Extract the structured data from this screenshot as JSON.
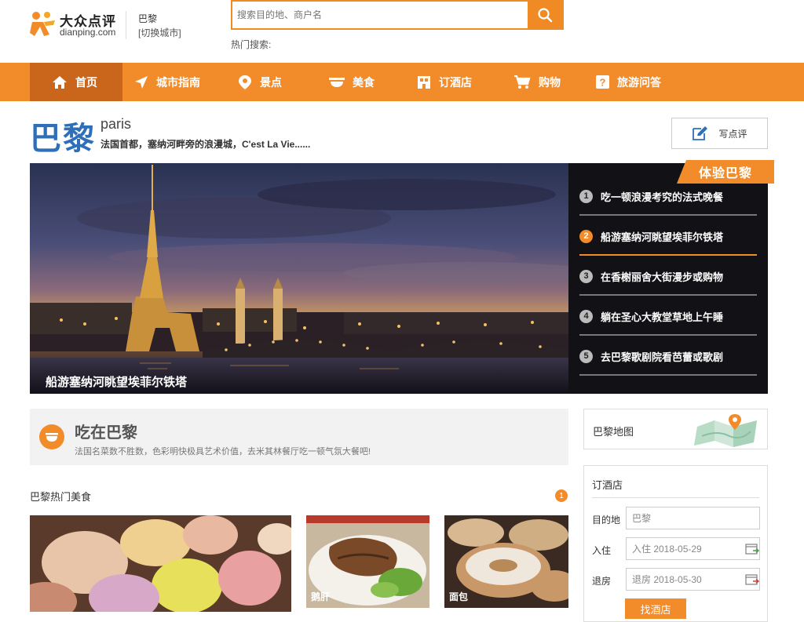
{
  "header": {
    "logo_cn": "大众点评",
    "logo_en": "dianping.com",
    "city": "巴黎",
    "city_switch": "[切换城市]",
    "search_placeholder": "搜索目的地、商户名",
    "hot_label": "热门搜索:"
  },
  "nav": [
    {
      "label": "首页",
      "icon": "home-icon",
      "active": true
    },
    {
      "label": "城市指南",
      "icon": "navigation-arrow-icon"
    },
    {
      "label": "景点",
      "icon": "location-pin-icon"
    },
    {
      "label": "美食",
      "icon": "food-bowl-icon"
    },
    {
      "label": "订酒店",
      "icon": "hotel-icon"
    },
    {
      "label": "购物",
      "icon": "shopping-cart-icon"
    },
    {
      "label": "旅游问答",
      "icon": "question-icon"
    }
  ],
  "city_title": {
    "cn": "巴黎",
    "en": "paris",
    "subtitle": "法国首都，塞纳河畔旁的浪漫城，C'est La Vie......",
    "review_button": "写点评"
  },
  "banner": {
    "caption": "船游塞纳河眺望埃菲尔铁塔",
    "tag": "体验巴黎",
    "items": [
      {
        "num": "1",
        "label": "吃一顿浪漫考究的法式晚餐"
      },
      {
        "num": "2",
        "label": "船游塞纳河眺望埃菲尔铁塔",
        "active": true
      },
      {
        "num": "3",
        "label": "在香榭丽舍大街漫步或购物"
      },
      {
        "num": "4",
        "label": "躺在圣心大教堂草地上午睡"
      },
      {
        "num": "5",
        "label": "去巴黎歌剧院看芭蕾或歌剧"
      }
    ]
  },
  "eat": {
    "title": "吃在巴黎",
    "desc": "法国名菜数不胜数，色彩明快极具艺术价值，去米其林餐厅吃一顿气氛大餐吧!",
    "hot_title": "巴黎热门美食",
    "page_badge": "1",
    "cards": [
      {
        "label": ""
      },
      {
        "label": "鹅肝"
      },
      {
        "label": "面包"
      }
    ]
  },
  "sidebar": {
    "map_label": "巴黎地图",
    "hotel": {
      "title": "订酒店",
      "dest_label": "目的地",
      "dest_value": "巴黎",
      "checkin_label": "入住",
      "checkin_value": "入住 2018-05-29",
      "checkout_label": "退房",
      "checkout_value": "退房 2018-05-30",
      "find_button": "找酒店"
    }
  },
  "colors": {
    "accent": "#f28c2b",
    "nav_active": "#c9661c",
    "title_blue": "#2e6fb8"
  }
}
